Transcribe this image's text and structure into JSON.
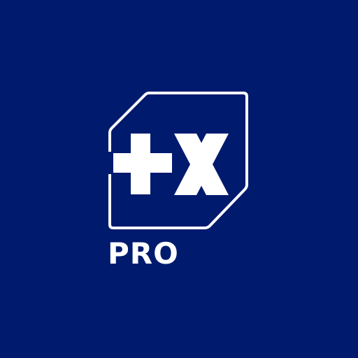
{
  "app_icon": {
    "logo": {
      "icon_name": "plus-x-logo",
      "text": "+X"
    },
    "badge_text": "PRO"
  },
  "colors": {
    "background": "#001a6e",
    "foreground": "#ffffff"
  }
}
